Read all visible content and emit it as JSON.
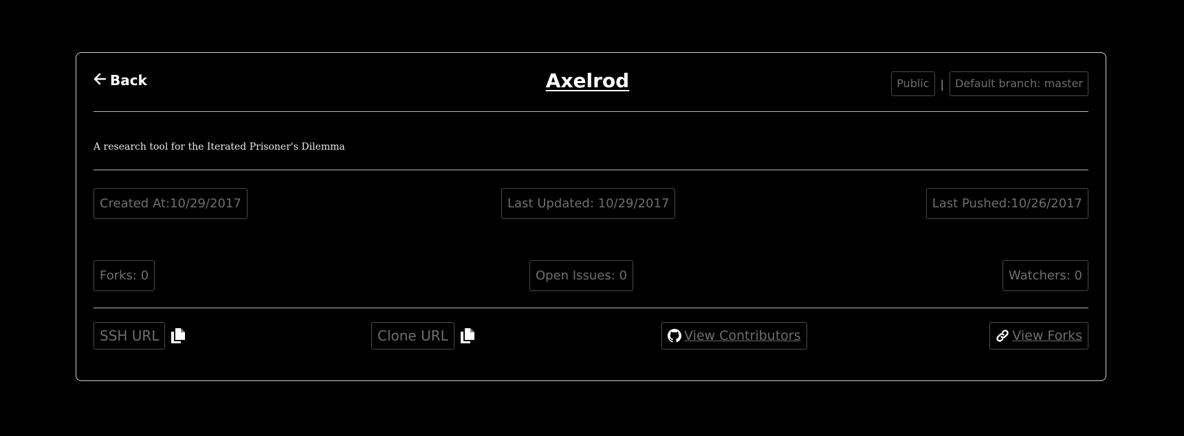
{
  "header": {
    "back_label": "Back",
    "title": "Axelrod",
    "visibility": "Public",
    "separator": "|",
    "default_branch": "Default branch: master"
  },
  "description": "A research tool for the Iterated Prisoner's Dilemma",
  "dates": {
    "created": "Created At:10/29/2017",
    "updated": "Last Updated: 10/29/2017",
    "pushed": "Last Pushed:10/26/2017"
  },
  "stats": {
    "forks": "Forks: 0",
    "open_issues": "Open Issues: 0",
    "watchers": "Watchers: 0"
  },
  "actions": {
    "ssh_url": "SSH URL",
    "clone_url": "Clone URL",
    "view_contributors": " View Contributors",
    "view_forks": " View Forks"
  },
  "icons": {
    "back": "arrow-left-icon",
    "copy": "copy-icon",
    "github": "github-icon",
    "link": "link-icon"
  },
  "colors": {
    "background": "#000000",
    "border": "#d0d0d0",
    "muted_text": "#6e6e6e",
    "pill_border": "#4a4a4a"
  }
}
